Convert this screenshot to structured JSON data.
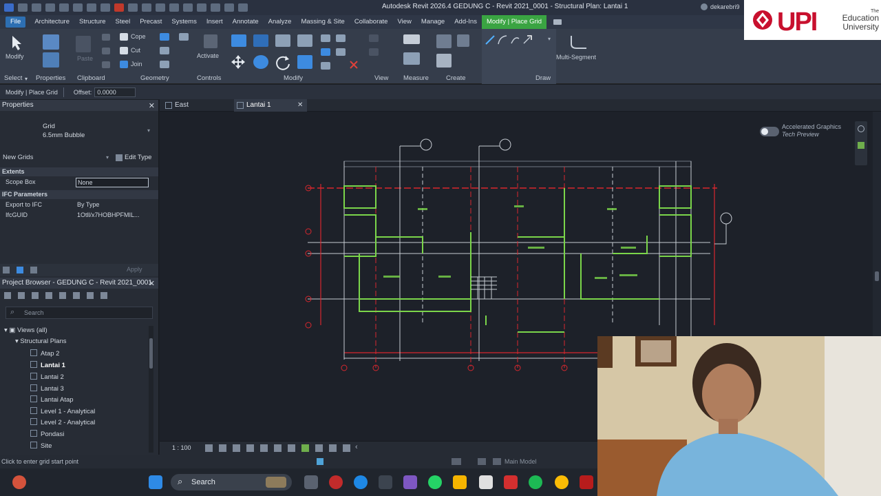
{
  "titlebar": {
    "title": "Autodesk Revit 2026.4    GEDUNG C - Revit 2021_0001 - Structural Plan: Lantai 1",
    "user": "dekarebri9"
  },
  "menu": {
    "tabs": [
      "File",
      "Architecture",
      "Structure",
      "Steel",
      "Precast",
      "Systems",
      "Insert",
      "Annotate",
      "Analyze",
      "Massing & Site",
      "Collaborate",
      "View",
      "Manage",
      "Add-Ins",
      "Modify | Place Grid"
    ]
  },
  "ribbon": {
    "groups": {
      "select": "Select",
      "properties": "Properties",
      "clipboard": "Clipboard",
      "geometry": "Geometry",
      "controls": "Controls",
      "modify": "Modify",
      "view": "View",
      "measure": "Measure",
      "create": "Create",
      "draw": "Draw"
    },
    "buttons": {
      "modify": "Modify",
      "paste": "Paste",
      "cope": "Cope",
      "cut": "Cut",
      "join": "Join",
      "activate": "Activate",
      "multi_segment": "Multi-Segment"
    }
  },
  "options": {
    "context": "Modify | Place Grid",
    "offset_label": "Offset:",
    "offset_value": "0.0000"
  },
  "properties": {
    "title": "Properties",
    "type_family": "Grid",
    "type_name": "6.5mm Bubble",
    "instance_dropdown": "New Grids",
    "edit_type": "Edit Type",
    "sections": {
      "extents": "Extents",
      "ifc": "IFC Parameters"
    },
    "rows": {
      "scope_box_label": "Scope Box",
      "scope_box_value": "None",
      "export_ifc_label": "Export to IFC",
      "export_ifc_value": "By Type",
      "ifcguid_label": "IfcGUID",
      "ifcguid_value": "1Otll/x7HOBHPFMIL..."
    },
    "apply": "Apply"
  },
  "browser": {
    "title": "Project Browser - GEDUNG C - Revit 2021_0001",
    "search_placeholder": "Search",
    "views_root": "Views (all)",
    "structural_plans": "Structural Plans",
    "items": [
      "Atap 2",
      "Lantai 1",
      "Lantai 2",
      "Lantai 3",
      "Lantai Atap",
      "Level 1 - Analytical",
      "Level 2 - Analytical",
      "Pondasi",
      "Site"
    ],
    "selected_index": 1
  },
  "view_tabs": {
    "tabs": [
      "East",
      "Lantai 1"
    ],
    "active_index": 1
  },
  "canvas": {
    "accelerated_graphics": "Accelerated Graphics",
    "tech_preview": "Tech Preview"
  },
  "viewbar": {
    "scale": "1 : 100"
  },
  "status": {
    "message": "Click to enter grid start point",
    "model": "Main Model"
  },
  "taskbar": {
    "search_label": "Search"
  },
  "logo": {
    "brand": "UPI",
    "the": "The",
    "line1": "Education",
    "line2": "University"
  },
  "colors": {
    "accent_green": "#3aa442",
    "file_blue": "#2d6fb3",
    "grid_red": "#d9272e",
    "wall_green": "#7bd64a"
  }
}
